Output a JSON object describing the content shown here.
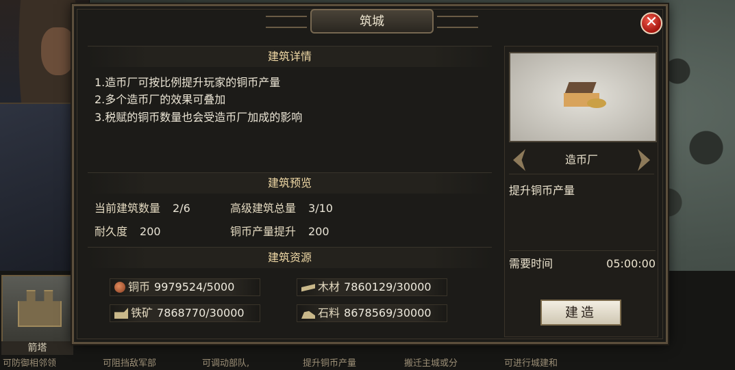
{
  "dialog": {
    "title": "筑城",
    "close_icon": "close-icon"
  },
  "details": {
    "heading": "建筑详情",
    "lines": [
      "1.造币厂可按比例提升玩家的铜币产量",
      "2.多个造币厂的效果可叠加",
      "3.税赋的铜币数量也会受造币厂加成的影响"
    ]
  },
  "preview": {
    "heading": "建筑预览",
    "stats": [
      {
        "label": "当前建筑数量",
        "value": "2/6"
      },
      {
        "label": "高级建筑总量",
        "value": "3/10"
      },
      {
        "label": "耐久度",
        "value": "200"
      },
      {
        "label": "铜币产量提升",
        "value": "200"
      }
    ]
  },
  "resources": {
    "heading": "建筑资源",
    "items": [
      {
        "icon": "copper-coin-icon",
        "label": "铜币",
        "amount": "9979524/5000"
      },
      {
        "icon": "wood-icon",
        "label": "木材",
        "amount": "7860129/30000"
      },
      {
        "icon": "iron-ore-icon",
        "label": "铁矿",
        "amount": "7868770/30000"
      },
      {
        "icon": "stone-icon",
        "label": "石料",
        "amount": "8678569/30000"
      }
    ]
  },
  "building": {
    "name": "造币厂",
    "description": "提升铜币产量",
    "time_label": "需要时间",
    "time_value": "05:00:00",
    "build_label": "建造"
  },
  "background": {
    "card_name": "箭塔",
    "descriptions": [
      "可防御相邻领",
      "可阻挡敌军部",
      "可调动部队,",
      "提升铜币产量",
      "搬迁主城或分",
      "可进行城建和"
    ]
  }
}
